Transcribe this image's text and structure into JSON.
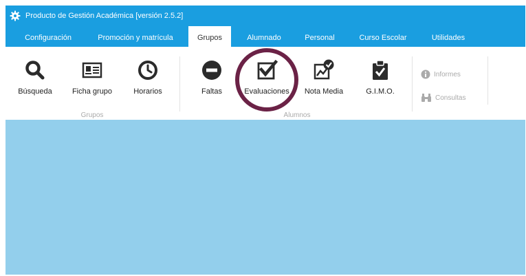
{
  "window": {
    "title": "Producto de Gestión Académica [versión 2.5.2]"
  },
  "tabs": [
    {
      "label": "Configuración",
      "active": false
    },
    {
      "label": "Promoción y matrícula",
      "active": false
    },
    {
      "label": "Grupos",
      "active": true
    },
    {
      "label": "Alumnado",
      "active": false
    },
    {
      "label": "Personal",
      "active": false
    },
    {
      "label": "Curso Escolar",
      "active": false
    },
    {
      "label": "Utilidades",
      "active": false
    }
  ],
  "ribbon": {
    "groups": {
      "grupos": {
        "label": "Grupos",
        "buttons": [
          {
            "label": "Búsqueda",
            "icon": "search-icon"
          },
          {
            "label": "Ficha grupo",
            "icon": "id-card-icon"
          },
          {
            "label": "Horarios",
            "icon": "clock-icon"
          }
        ]
      },
      "alumnos": {
        "label": "Alumnos",
        "buttons": [
          {
            "label": "Faltas",
            "icon": "minus-circle-icon"
          },
          {
            "label": "Evaluaciones",
            "icon": "checkbox-icon",
            "highlighted": true
          },
          {
            "label": "Nota Media",
            "icon": "chart-check-icon"
          },
          {
            "label": "G.I.M.O.",
            "icon": "clipboard-check-icon"
          }
        ]
      },
      "extra": {
        "items": [
          {
            "label": "Informes",
            "icon": "info-icon",
            "enabled": false
          },
          {
            "label": "Consultas",
            "icon": "binoculars-icon",
            "enabled": false
          }
        ]
      }
    }
  },
  "colors": {
    "title_bar": "#1a9ee0",
    "work_area": "#93cfec",
    "highlight_ring": "#6b2246",
    "icon": "#2b2b2b",
    "disabled_text": "#aaaaaa"
  }
}
